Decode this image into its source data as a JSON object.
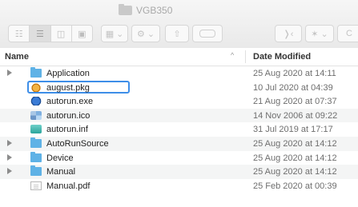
{
  "window": {
    "title": "VGB350"
  },
  "toolbar": {
    "view_buttons": [
      "icon-view",
      "list-view",
      "column-view",
      "gallery-view"
    ],
    "group_button": "group-by",
    "action_button": "action-gear",
    "share_button": "share",
    "tag_button": "tag",
    "dropdown_glyph": "⌄",
    "extra1": "❭‹",
    "extra2": "✶",
    "extra3": "C"
  },
  "columns": {
    "name": "Name",
    "date": "Date Modified",
    "sort_indicator": "^"
  },
  "files": [
    {
      "name": "Application",
      "date": "25 Aug 2020 at 14:11",
      "kind": "folder",
      "expandable": true
    },
    {
      "name": "august.pkg",
      "date": "10 Jul 2020 at 04:39",
      "kind": "pkg",
      "expandable": false,
      "selected": true
    },
    {
      "name": "autorun.exe",
      "date": "21 Aug 2020 at 07:37",
      "kind": "exe",
      "expandable": false
    },
    {
      "name": "autorun.ico",
      "date": "14 Nov 2006 at 09:22",
      "kind": "ico",
      "expandable": false
    },
    {
      "name": "autorun.inf",
      "date": "31 Jul 2019 at 17:17",
      "kind": "inf",
      "expandable": false
    },
    {
      "name": "AutoRunSource",
      "date": "25 Aug 2020 at 14:12",
      "kind": "folder",
      "expandable": true
    },
    {
      "name": "Device",
      "date": "25 Aug 2020 at 14:12",
      "kind": "folder",
      "expandable": true
    },
    {
      "name": "Manual",
      "date": "25 Aug 2020 at 14:12",
      "kind": "folder",
      "expandable": true
    },
    {
      "name": "Manual.pdf",
      "date": "25 Feb 2020 at 00:39",
      "kind": "doc",
      "expandable": false
    }
  ],
  "colors": {
    "folder": "#5fb2e6",
    "selection": "#3e8ee8"
  }
}
